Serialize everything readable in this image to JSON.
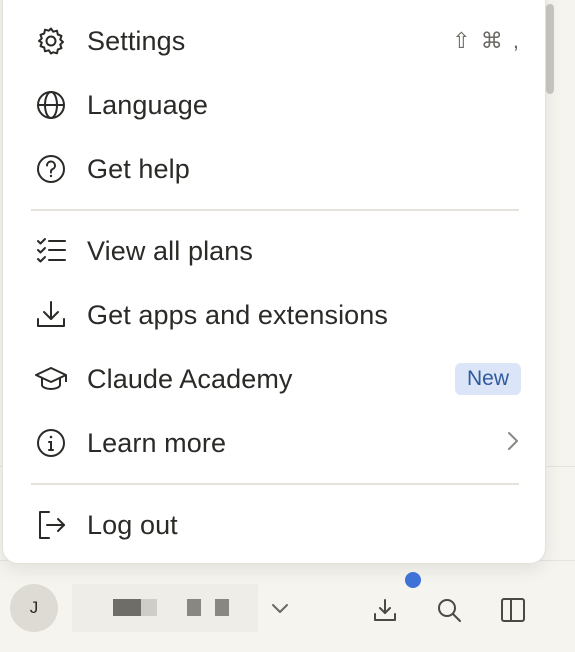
{
  "menu": {
    "items": [
      {
        "label": "Settings",
        "icon": "gear-icon",
        "shortcut": "⇧ ⌘ ,"
      },
      {
        "label": "Language",
        "icon": "globe-icon"
      },
      {
        "label": "Get help",
        "icon": "help-circle-icon"
      },
      {
        "label": "View all plans",
        "icon": "checklist-icon"
      },
      {
        "label": "Get apps and extensions",
        "icon": "download-icon"
      },
      {
        "label": "Claude Academy",
        "icon": "graduation-cap-icon",
        "badge": "New"
      },
      {
        "label": "Learn more",
        "icon": "info-circle-icon",
        "trail_icon": "chevron-right-icon"
      },
      {
        "label": "Log out",
        "icon": "logout-icon"
      }
    ]
  },
  "bottom_bar": {
    "avatar_initial": "J",
    "icons": [
      "chevron-down-icon",
      "download-icon",
      "search-icon",
      "sidebar-panel-icon"
    ],
    "notification_dot_color": "#3f72d6"
  },
  "colors": {
    "badge_bg": "#dbe5f7",
    "badge_text": "#2f5a9e",
    "text": "#2b2a27"
  }
}
